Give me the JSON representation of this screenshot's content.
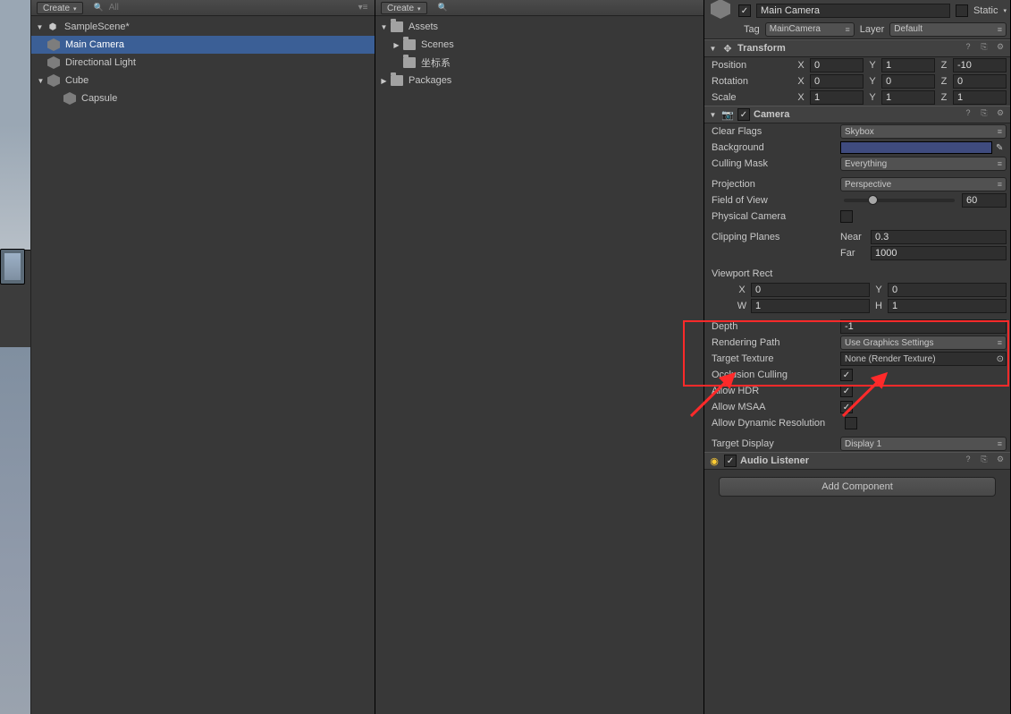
{
  "hierarchy": {
    "create": "Create",
    "searchHint": "All",
    "scene": "SampleScene*",
    "items": [
      "Main Camera",
      "Directional Light",
      "Cube",
      "Capsule"
    ]
  },
  "project": {
    "create": "Create",
    "assets": "Assets",
    "folders": [
      "Scenes",
      "坐标系"
    ],
    "packages": "Packages"
  },
  "inspector": {
    "name": "Main Camera",
    "static": "Static",
    "tagLabel": "Tag",
    "tag": "MainCamera",
    "layerLabel": "Layer",
    "layer": "Default",
    "transform": {
      "title": "Transform",
      "position": "Position",
      "rotation": "Rotation",
      "scale": "Scale",
      "pos": {
        "x": "0",
        "y": "1",
        "z": "-10"
      },
      "rot": {
        "x": "0",
        "y": "0",
        "z": "0"
      },
      "scl": {
        "x": "1",
        "y": "1",
        "z": "1"
      }
    },
    "camera": {
      "title": "Camera",
      "clearFlagsL": "Clear Flags",
      "clearFlags": "Skybox",
      "backgroundL": "Background",
      "cullingMaskL": "Culling Mask",
      "cullingMask": "Everything",
      "projectionL": "Projection",
      "projection": "Perspective",
      "fovL": "Field of View",
      "fov": "60",
      "physicalL": "Physical Camera",
      "clipL": "Clipping Planes",
      "nearL": "Near",
      "near": "0.3",
      "farL": "Far",
      "far": "1000",
      "viewportL": "Viewport Rect",
      "vx": "0",
      "vy": "0",
      "vw": "1",
      "vh": "1",
      "depthL": "Depth",
      "depth": "-1",
      "renderPathL": "Rendering Path",
      "renderPath": "Use Graphics Settings",
      "targetTexL": "Target Texture",
      "targetTex": "None (Render Texture)",
      "occlusionL": "Occlusion Culling",
      "hdrL": "Allow HDR",
      "msaaL": "Allow MSAA",
      "dynResL": "Allow Dynamic Resolution",
      "targetDispL": "Target Display",
      "targetDisp": "Display 1"
    },
    "audioListener": "Audio Listener",
    "addComponent": "Add Component"
  }
}
